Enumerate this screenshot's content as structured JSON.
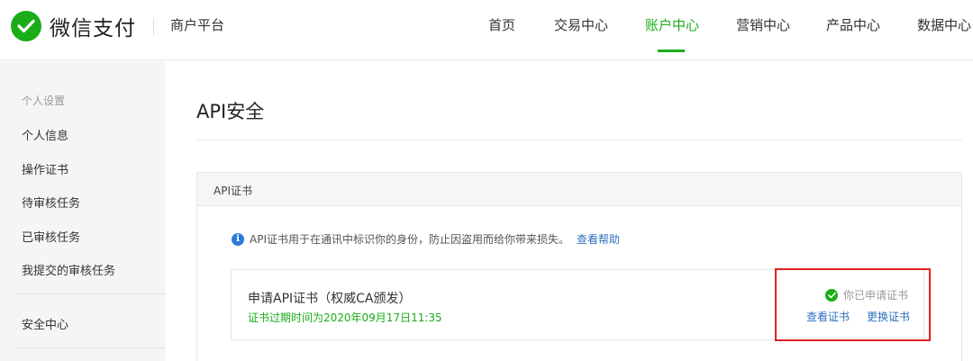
{
  "header": {
    "logo_text": "微信支付",
    "platform": "商户平台",
    "nav": [
      {
        "label": "首页"
      },
      {
        "label": "交易中心"
      },
      {
        "label": "账户中心"
      },
      {
        "label": "营销中心"
      },
      {
        "label": "产品中心"
      },
      {
        "label": "数据中心"
      }
    ],
    "active_nav": "账户中心"
  },
  "sidebar": {
    "group_label": "个人设置",
    "items": [
      {
        "label": "个人信息"
      },
      {
        "label": "操作证书"
      },
      {
        "label": "待审核任务"
      },
      {
        "label": "已审核任务"
      },
      {
        "label": "我提交的审核任务"
      }
    ],
    "security_label": "安全中心"
  },
  "main": {
    "title": "API安全",
    "panel": {
      "header": "API证书",
      "info_text": "API证书用于在通讯中标识你的身份，防止因盗用而给你带来损失。",
      "help_link": "查看帮助",
      "cert": {
        "name": "申请API证书（权威CA颁发）",
        "expire": "证书过期时间为2020年09月17日11:35",
        "status": "你已申请证书",
        "view_link": "查看证书",
        "replace_link": "更换证书"
      }
    }
  },
  "colors": {
    "brand_green": "#1aad19",
    "link_blue": "#2f6fbf",
    "highlight_red": "#e02020",
    "info_blue": "#2f7ad8"
  },
  "icons": {
    "logo": "wechat-pay-logo-icon",
    "info": "info-icon",
    "status": "check-circle-icon"
  }
}
